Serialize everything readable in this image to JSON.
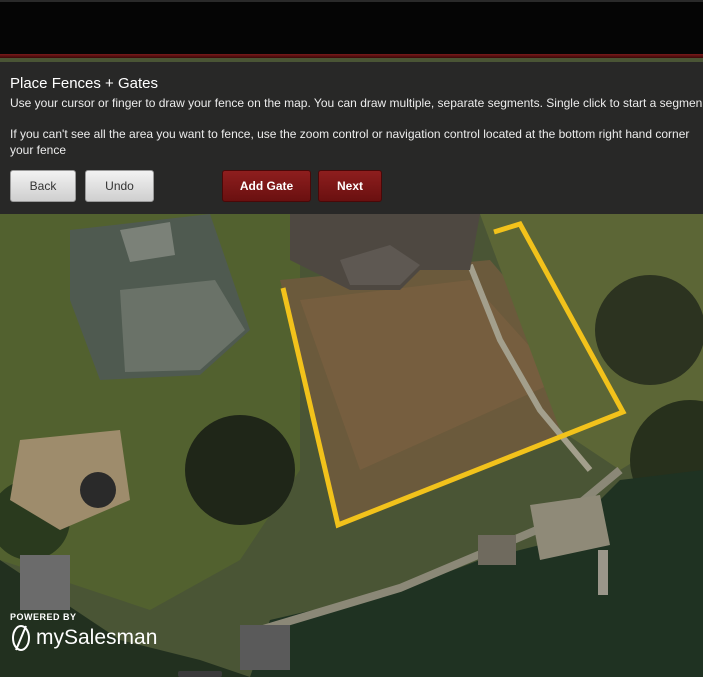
{
  "panel": {
    "title": "Place Fences + Gates",
    "instructions_1": "Use your cursor or finger to draw your fence on the map. You can draw multiple, separate segments. Single click to start a segmen",
    "instructions_2a": "If you can't see all the area you want to fence, use the zoom control or navigation control located at the bottom right hand corner",
    "instructions_2b": "your fence"
  },
  "buttons": {
    "back": "Back",
    "undo": "Undo",
    "add_gate": "Add Gate",
    "next": "Next"
  },
  "branding": {
    "powered_by": "POWERED BY",
    "name": "mySalesman"
  },
  "colors": {
    "fence": "#f2c21b",
    "accent_red": "#7a1616",
    "panel_bg": "#262626"
  }
}
